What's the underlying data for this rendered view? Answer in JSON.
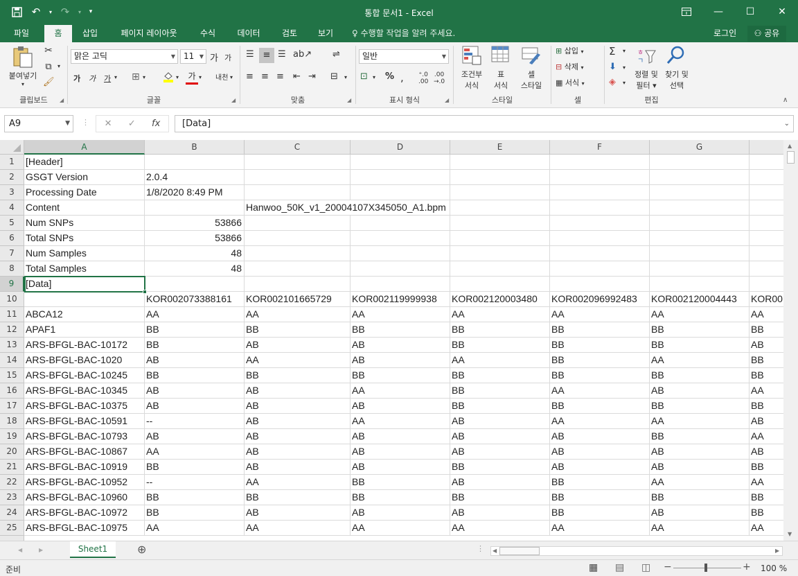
{
  "window": {
    "title": "통합 문서1 - Excel",
    "minimize": "—",
    "maximize": "☐",
    "close": "✕"
  },
  "tabs": [
    {
      "label": "파일"
    },
    {
      "label": "홈"
    },
    {
      "label": "삽입"
    },
    {
      "label": "페이지 레이아웃"
    },
    {
      "label": "수식"
    },
    {
      "label": "데이터"
    },
    {
      "label": "검토"
    },
    {
      "label": "보기"
    }
  ],
  "tell_me": "수행할 작업을 알려 주세요.",
  "login": "로그인",
  "share": "공유",
  "ribbon": {
    "clipboard": {
      "paste": "붙여넣기",
      "label": "클립보드"
    },
    "font": {
      "name": "맑은 고딕",
      "size": "11",
      "label": "글꼴",
      "grow": "가",
      "shrink": "가",
      "bold": "가",
      "italic": "가",
      "underline": "가",
      "color": "가",
      "phonetic": "내천"
    },
    "align": {
      "label": "맞춤"
    },
    "number": {
      "format": "일반",
      "percent": "%",
      "label": "표시 형식"
    },
    "styles": {
      "cond1": "조건부",
      "cond2": "서식",
      "table1": "표",
      "table2": "서식",
      "cell1": "셀",
      "cell2": "스타일",
      "label": "스타일"
    },
    "cells": {
      "insert": "삽입",
      "delete": "삭제",
      "format": "서식",
      "label": "셀"
    },
    "editing": {
      "sort1": "정렬 및",
      "sort2": "필터",
      "find1": "찾기 및",
      "find2": "선택",
      "label": "편집"
    }
  },
  "namebox": "A9",
  "formula": "[Data]",
  "columns": [
    "A",
    "B",
    "C",
    "D",
    "E",
    "F",
    "G"
  ],
  "rows": [
    {
      "n": "1",
      "a": "[Header]"
    },
    {
      "n": "2",
      "a": "GSGT Version",
      "b": "2.0.4"
    },
    {
      "n": "3",
      "a": "Processing Date",
      "b": "1/8/2020 8:49 PM"
    },
    {
      "n": "4",
      "a": "Content",
      "c": "Hanwoo_50K_v1_20004107X345050_A1.bpm"
    },
    {
      "n": "5",
      "a": "Num SNPs",
      "b": "53866"
    },
    {
      "n": "6",
      "a": "Total SNPs",
      "b": "53866"
    },
    {
      "n": "7",
      "a": "Num Samples",
      "b": "48"
    },
    {
      "n": "8",
      "a": "Total Samples",
      "b": "48"
    },
    {
      "n": "9",
      "a": "[Data]"
    },
    {
      "n": "10",
      "a": "",
      "b": "KOR002073388161",
      "c": "KOR002101665729",
      "d": "KOR002119999938",
      "e": "KOR002120003480",
      "f": "KOR002096992483",
      "g": "KOR002120004443",
      "h": "KOR00"
    },
    {
      "n": "11",
      "a": "ABCA12",
      "b": "AA",
      "c": "AA",
      "d": "AA",
      "e": "AA",
      "f": "AA",
      "g": "AA",
      "h": "AA"
    },
    {
      "n": "12",
      "a": "APAF1",
      "b": "BB",
      "c": "BB",
      "d": "BB",
      "e": "BB",
      "f": "BB",
      "g": "BB",
      "h": "BB"
    },
    {
      "n": "13",
      "a": "ARS-BFGL-BAC-10172",
      "b": "BB",
      "c": "AB",
      "d": "AB",
      "e": "BB",
      "f": "BB",
      "g": "BB",
      "h": "AB"
    },
    {
      "n": "14",
      "a": "ARS-BFGL-BAC-1020",
      "b": "AB",
      "c": "AA",
      "d": "AB",
      "e": "AA",
      "f": "BB",
      "g": "AA",
      "h": "BB"
    },
    {
      "n": "15",
      "a": "ARS-BFGL-BAC-10245",
      "b": "BB",
      "c": "BB",
      "d": "BB",
      "e": "BB",
      "f": "BB",
      "g": "BB",
      "h": "BB"
    },
    {
      "n": "16",
      "a": "ARS-BFGL-BAC-10345",
      "b": "AB",
      "c": "AB",
      "d": "AA",
      "e": "BB",
      "f": "AA",
      "g": "AB",
      "h": "AA"
    },
    {
      "n": "17",
      "a": "ARS-BFGL-BAC-10375",
      "b": "AB",
      "c": "AB",
      "d": "AB",
      "e": "BB",
      "f": "BB",
      "g": "BB",
      "h": "BB"
    },
    {
      "n": "18",
      "a": "ARS-BFGL-BAC-10591",
      "b": "--",
      "c": "AB",
      "d": "AA",
      "e": "AB",
      "f": "AA",
      "g": "AA",
      "h": "AB"
    },
    {
      "n": "19",
      "a": "ARS-BFGL-BAC-10793",
      "b": "AB",
      "c": "AB",
      "d": "AB",
      "e": "AB",
      "f": "AB",
      "g": "BB",
      "h": "AA"
    },
    {
      "n": "20",
      "a": "ARS-BFGL-BAC-10867",
      "b": "AA",
      "c": "AB",
      "d": "AB",
      "e": "AB",
      "f": "AB",
      "g": "AB",
      "h": "AB"
    },
    {
      "n": "21",
      "a": "ARS-BFGL-BAC-10919",
      "b": "BB",
      "c": "AB",
      "d": "AB",
      "e": "BB",
      "f": "AB",
      "g": "AB",
      "h": "BB"
    },
    {
      "n": "22",
      "a": "ARS-BFGL-BAC-10952",
      "b": "--",
      "c": "AA",
      "d": "BB",
      "e": "AB",
      "f": "BB",
      "g": "AA",
      "h": "AA"
    },
    {
      "n": "23",
      "a": "ARS-BFGL-BAC-10960",
      "b": "BB",
      "c": "BB",
      "d": "BB",
      "e": "BB",
      "f": "BB",
      "g": "BB",
      "h": "BB"
    },
    {
      "n": "24",
      "a": "ARS-BFGL-BAC-10972",
      "b": "BB",
      "c": "AB",
      "d": "AB",
      "e": "AB",
      "f": "BB",
      "g": "AB",
      "h": "BB"
    },
    {
      "n": "25",
      "a": "ARS-BFGL-BAC-10975",
      "b": "AA",
      "c": "AA",
      "d": "AA",
      "e": "AA",
      "f": "AA",
      "g": "AA",
      "h": "AA"
    }
  ],
  "sheet_tab": "Sheet1",
  "status": {
    "ready": "준비",
    "zoom": "100 %"
  },
  "colors": {
    "accent": "#217346",
    "ribbon": "#f3f3f3"
  }
}
